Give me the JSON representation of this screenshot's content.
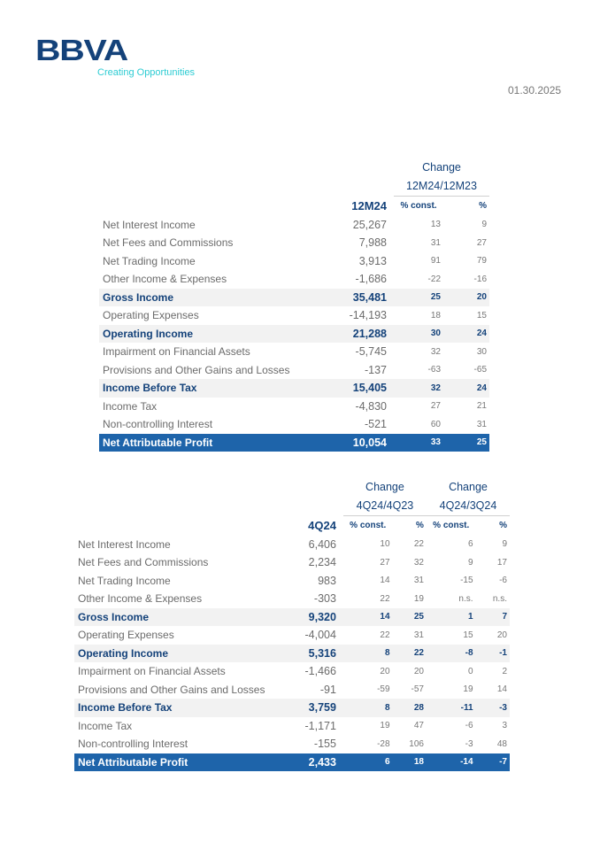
{
  "header": {
    "brand": "BBVA",
    "tagline": "Creating Opportunities",
    "date": "01.30.2025"
  },
  "colors": {
    "brand_navy": "#14427a",
    "accent_cyan": "#2dccd3",
    "total_row_bg": "#1e64aa",
    "highlight_row_bg": "#f2f2f2"
  },
  "table1": {
    "change_label": "Change",
    "period_compare": "12M24/12M23",
    "period": "12M24",
    "col_const": "% const.",
    "col_pct": "%",
    "rows": [
      {
        "label": "Net Interest Income",
        "value": "25,267",
        "const": "13",
        "pct": "9"
      },
      {
        "label": "Net Fees and Commissions",
        "value": "7,988",
        "const": "31",
        "pct": "27"
      },
      {
        "label": "Net Trading Income",
        "value": "3,913",
        "const": "91",
        "pct": "79"
      },
      {
        "label": "Other Income & Expenses",
        "value": "-1,686",
        "const": "-22",
        "pct": "-16"
      },
      {
        "label": "Gross Income",
        "value": "35,481",
        "const": "25",
        "pct": "20"
      },
      {
        "label": "Operating Expenses",
        "value": "-14,193",
        "const": "18",
        "pct": "15"
      },
      {
        "label": "Operating Income",
        "value": "21,288",
        "const": "30",
        "pct": "24"
      },
      {
        "label": "Impairment on Financial Assets",
        "value": "-5,745",
        "const": "32",
        "pct": "30"
      },
      {
        "label": "Provisions and Other Gains and Losses",
        "value": "-137",
        "const": "-63",
        "pct": "-65"
      },
      {
        "label": "Income Before Tax",
        "value": "15,405",
        "const": "32",
        "pct": "24"
      },
      {
        "label": "Income Tax",
        "value": "-4,830",
        "const": "27",
        "pct": "21"
      },
      {
        "label": "Non-controlling Interest",
        "value": "-521",
        "const": "60",
        "pct": "31"
      },
      {
        "label": "Net Attributable Profit",
        "value": "10,054",
        "const": "33",
        "pct": "25"
      }
    ]
  },
  "table2": {
    "change_label_1": "Change",
    "period_compare_1": "4Q24/4Q23",
    "change_label_2": "Change",
    "period_compare_2": "4Q24/3Q24",
    "period": "4Q24",
    "col_const": "% const.",
    "col_pct": "%",
    "rows": [
      {
        "label": "Net Interest Income",
        "value": "6,406",
        "c1": "10",
        "p1": "22",
        "c2": "6",
        "p2": "9"
      },
      {
        "label": "Net Fees and Commissions",
        "value": "2,234",
        "c1": "27",
        "p1": "32",
        "c2": "9",
        "p2": "17"
      },
      {
        "label": "Net Trading Income",
        "value": "983",
        "c1": "14",
        "p1": "31",
        "c2": "-15",
        "p2": "-6"
      },
      {
        "label": "Other Income & Expenses",
        "value": "-303",
        "c1": "22",
        "p1": "19",
        "c2": "n.s.",
        "p2": "n.s."
      },
      {
        "label": "Gross Income",
        "value": "9,320",
        "c1": "14",
        "p1": "25",
        "c2": "1",
        "p2": "7"
      },
      {
        "label": "Operating Expenses",
        "value": "-4,004",
        "c1": "22",
        "p1": "31",
        "c2": "15",
        "p2": "20"
      },
      {
        "label": "Operating Income",
        "value": "5,316",
        "c1": "8",
        "p1": "22",
        "c2": "-8",
        "p2": "-1"
      },
      {
        "label": "Impairment on Financial Assets",
        "value": "-1,466",
        "c1": "20",
        "p1": "20",
        "c2": "0",
        "p2": "2"
      },
      {
        "label": "Provisions and Other Gains and Losses",
        "value": "-91",
        "c1": "-59",
        "p1": "-57",
        "c2": "19",
        "p2": "14"
      },
      {
        "label": "Income Before Tax",
        "value": "3,759",
        "c1": "8",
        "p1": "28",
        "c2": "-11",
        "p2": "-3"
      },
      {
        "label": "Income Tax",
        "value": "-1,171",
        "c1": "19",
        "p1": "47",
        "c2": "-6",
        "p2": "3"
      },
      {
        "label": "Non-controlling Interest",
        "value": "-155",
        "c1": "-28",
        "p1": "106",
        "c2": "-3",
        "p2": "48"
      },
      {
        "label": "Net Attributable Profit",
        "value": "2,433",
        "c1": "6",
        "p1": "18",
        "c2": "-14",
        "p2": "-7"
      }
    ]
  }
}
